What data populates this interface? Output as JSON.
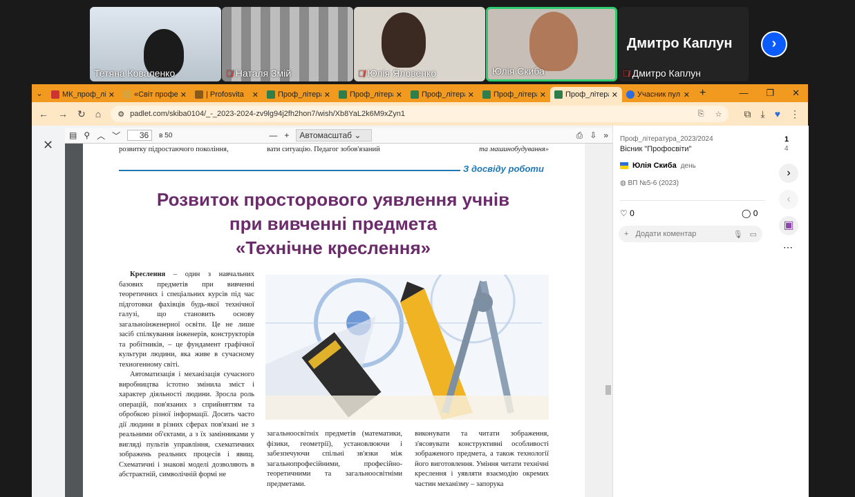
{
  "zoom": {
    "participants": [
      {
        "name": "Тетяна  Коваленко",
        "muted": false
      },
      {
        "name": "Наталя Змій",
        "muted": true
      },
      {
        "name": "Юлія Яловенко",
        "muted": true
      },
      {
        "name": "Юлія Скиба",
        "muted": false,
        "active": true
      },
      {
        "name": "Дмитро Каплун",
        "muted": true,
        "display_name": "Дмитро Каплун"
      }
    ]
  },
  "browser": {
    "tabs": [
      {
        "label": "МК_проф_лі"
      },
      {
        "label": "«Світ профе"
      },
      {
        "label": "| Profosvita"
      },
      {
        "label": "Проф_літера"
      },
      {
        "label": "Проф_літера"
      },
      {
        "label": "Проф_літера"
      },
      {
        "label": "Проф_літера"
      },
      {
        "label": "Проф_літера"
      },
      {
        "label": "Учасник пул"
      }
    ],
    "url": "padlet.com/skiba0104/_-_2023-2024-zv9lg94j2fh2hon7/wish/Xb8YaL2k6M9xZyn1"
  },
  "pdf": {
    "page": "36",
    "total": "в 50",
    "zoom": "Автомасштаб",
    "top_left": "розвитку підростаючого покоління,",
    "top_mid": "вати ситуацію. Педагог зобов'язаний",
    "top_right": "та машинобудування»",
    "section": "З досвіду роботи",
    "title_line1": "Розвиток просторового уявлення учнів",
    "title_line2": "при вивченні предмета",
    "title_line3": "«Технічне креслення»",
    "col1_p1_bold": "Креслення",
    "col1_p1": " – один з навчальних базових предметів при вивченні теоретичних і спеціальних курсів під час підготовки фахівців будь-якої технічної галузі, що становить основу загальноінженерної освіти. Це не лише засіб спілкування інженерів, конструкторів та робітників, – це фундамент графічної культури людини, яка живе в сучасному техногенному світі.",
    "col1_p2": "Автоматизація і механізація сучасного виробництва істотно змінила зміст і характер діяльності людини. Зросла роль операцій, пов'язаних з сприйняттям та обробкою різної інформації. Досить часто дії людини в різних сферах пов'язані не з реальними об'єктами, а з їх замінниками у вигляді пультів управління, схематичних зображень реальних процесів і явищ. Схематичні і знакові моделі дозволяють в абстрактній, символічній формі не",
    "col2": "загальноосвітніх предметів (математики, фізики, геометрії), установлюючи і забезпечуючи спільні зв'язки між загальнопрофесійними, професійно-теоретичними та загальноосвітніми предметами.",
    "col3": "виконувати та читати зображення, з'ясовувати конструктивні особливості зображеного предмета, а також технології його виготовлення. Уміння читати технічні креслення і уявляти взаємодію окремих частин механізму – запорука"
  },
  "padlet": {
    "breadcrumb": "Проф_література_2023/2024",
    "post_title": "Вісник \"Профосвіти\"",
    "page_num": "1",
    "page_total": "4",
    "author": "Юлія Скиба",
    "when": "день",
    "attachment": "ВП №5-6 (2023)",
    "likes": "0",
    "comments": "0",
    "comment_placeholder": "Додати коментар"
  }
}
